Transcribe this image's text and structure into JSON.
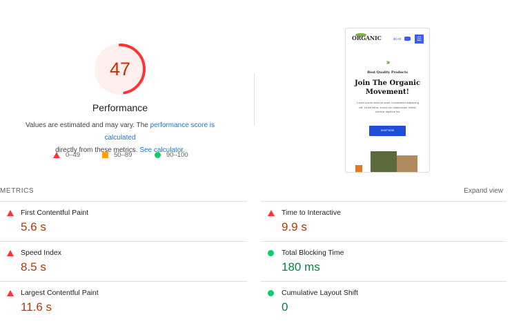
{
  "performance": {
    "score": "47",
    "score_fraction": 0.47,
    "title": "Performance",
    "desc_prefix": "Values are estimated and may vary. The ",
    "desc_link": "performance score is calculated",
    "desc_mid": " directly from these metrics. ",
    "desc_link2": "See calculator.",
    "colors": {
      "fail": "#ff3333",
      "fail_text": "#c33300",
      "average": "#ffa400",
      "pass": "#0cce6b",
      "pass_text": "#018642",
      "link": "#1a73e8"
    }
  },
  "legend": [
    {
      "icon": "triangle-icon",
      "label": "0–49"
    },
    {
      "icon": "square-icon",
      "label": "50–89"
    },
    {
      "icon": "circle-icon",
      "label": "90–100"
    }
  ],
  "screenshot": {
    "logo": "ORGANIC",
    "price": "$0.00",
    "menu_icon": "☰",
    "chevrons": "›››",
    "kicker": "Best Quality Products",
    "headline": "Join The Organic Movement!",
    "body": "Lorem ipsum dolor sit amet, consectetur adipiscing elit. Ut elit tellus, luctus nec ullamcorper mattis, pulvinar dapibus leo.",
    "button": "SHOP NOW"
  },
  "metrics_section": {
    "title": "METRICS",
    "expand": "Expand view"
  },
  "metrics": [
    {
      "label": "First Contentful Paint",
      "value": "5.6 s",
      "status": "fail"
    },
    {
      "label": "Time to Interactive",
      "value": "9.9 s",
      "status": "fail"
    },
    {
      "label": "Speed Index",
      "value": "8.5 s",
      "status": "fail"
    },
    {
      "label": "Total Blocking Time",
      "value": "180 ms",
      "status": "pass"
    },
    {
      "label": "Largest Contentful Paint",
      "value": "11.6 s",
      "status": "fail"
    },
    {
      "label": "Cumulative Layout Shift",
      "value": "0",
      "status": "pass"
    }
  ]
}
